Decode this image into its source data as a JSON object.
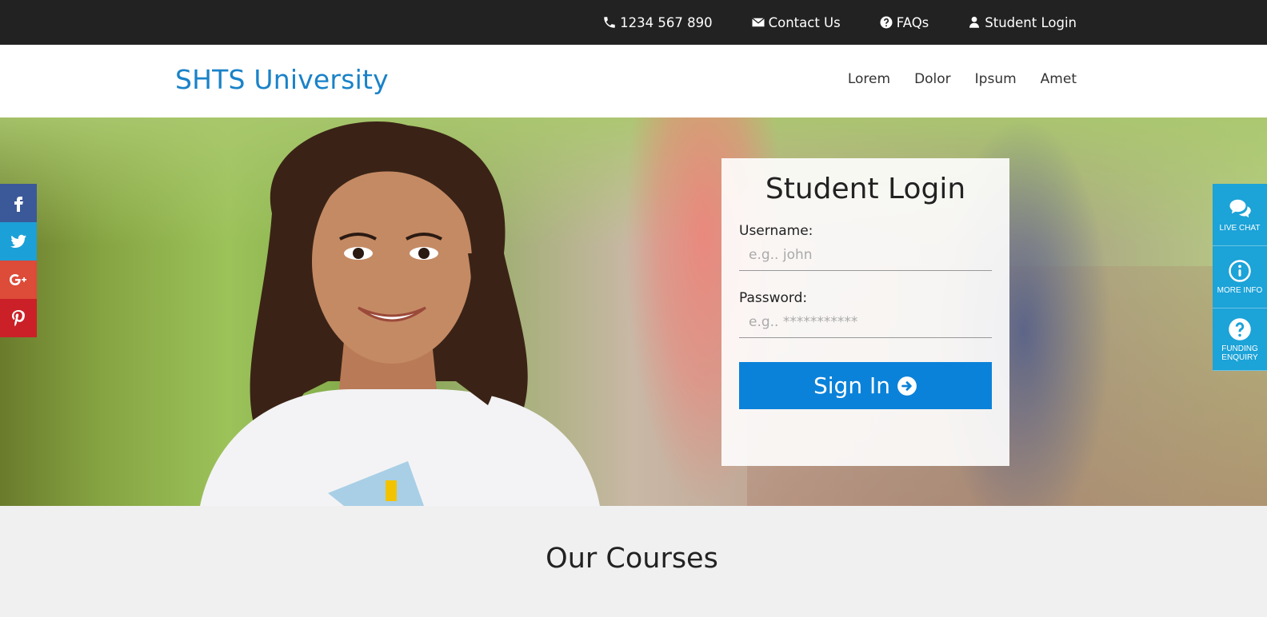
{
  "topbar": {
    "phone": "1234 567 890",
    "contact": "Contact Us",
    "faqs": "FAQs",
    "student_login": "Student Login"
  },
  "header": {
    "brand": "SHTS University",
    "nav": [
      "Lorem",
      "Dolor",
      "Ipsum",
      "Amet"
    ]
  },
  "login": {
    "title": "Student Login",
    "username_label": "Username:",
    "username_placeholder": "e.g.. john",
    "password_label": "Password:",
    "password_placeholder": "e.g.. ***********",
    "signin_label": "Sign In"
  },
  "social": [
    {
      "icon": "facebook-icon",
      "color": "#3b5998"
    },
    {
      "icon": "twitter-icon",
      "color": "#1da1f2"
    },
    {
      "icon": "google-plus-icon",
      "color": "#dd4b39"
    },
    {
      "icon": "pinterest-icon",
      "color": "#cb2027"
    }
  ],
  "widgets": [
    {
      "icon": "chat-icon",
      "label": "LIVE CHAT"
    },
    {
      "icon": "info-icon",
      "label": "MORE INFO"
    },
    {
      "icon": "question-icon",
      "label": "FUNDING ENQUIRY"
    }
  ],
  "courses": {
    "title": "Our Courses"
  }
}
